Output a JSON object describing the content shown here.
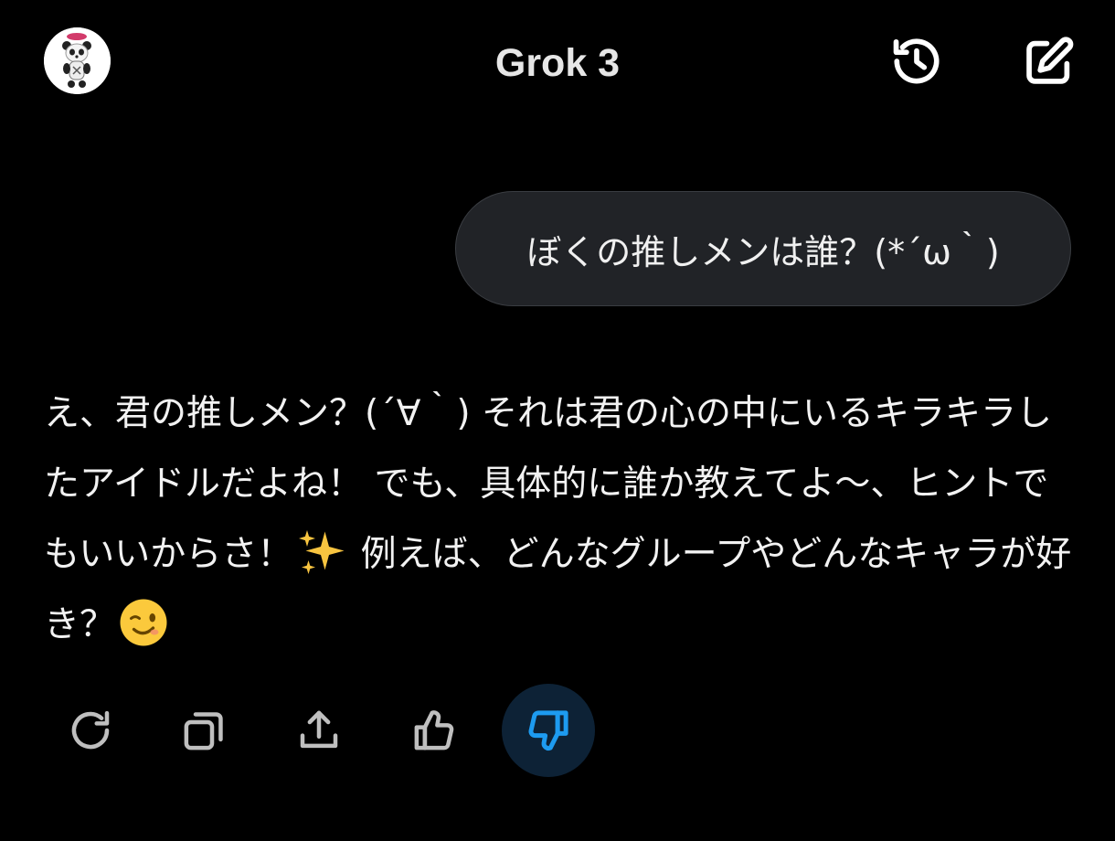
{
  "header": {
    "title": "Grok 3",
    "avatar_icon": "panda-avatar-icon",
    "history_icon": "history-icon",
    "new_chat_icon": "new-chat-icon"
  },
  "conversation": {
    "user_message": "ぼくの推しメンは誰？(*´ω｀)",
    "assistant_text_1": "え、君の推しメン？(´∀｀) それは君の心の中にいるキラキラしたアイドルだよね！ でも、具体的に誰か教えてよ〜、ヒントでもいいからさ！",
    "emoji_1": "sparkles-emoji",
    "assistant_text_2": " 例えば、どんなグループやどんなキャラが好き？",
    "emoji_2": "winking-face-emoji"
  },
  "actions": [
    {
      "icon": "regenerate-icon"
    },
    {
      "icon": "copy-icon"
    },
    {
      "icon": "share-icon"
    },
    {
      "icon": "thumbs-up-icon"
    },
    {
      "icon": "thumbs-down-icon",
      "active": true
    }
  ],
  "colors": {
    "background": "#000000",
    "bubble": "#212327",
    "icon": "#bfbfbf",
    "accent": "#1d9bf0",
    "active_bg": "#0d2236"
  }
}
